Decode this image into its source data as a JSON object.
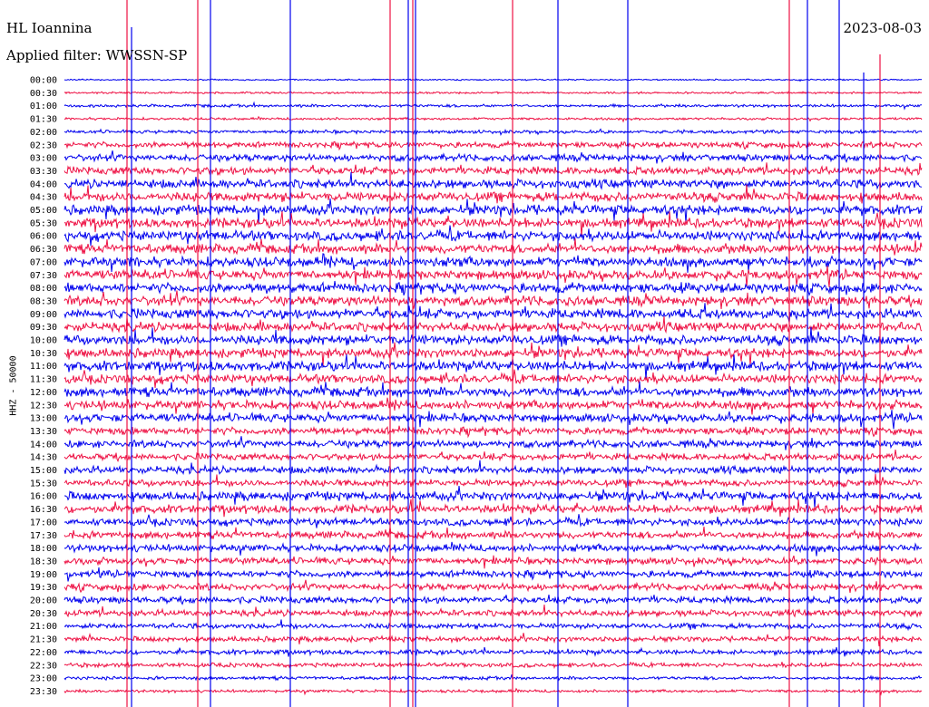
{
  "header": {
    "station": "HL Ioannina",
    "filter": "Applied filter: WWSSN-SP",
    "date": "2023-08-03"
  },
  "chart_data": {
    "type": "line",
    "title": "HL Ioannina",
    "ylabel": "HHZ - 50000",
    "rows": [
      "00:00",
      "00:30",
      "01:00",
      "01:30",
      "02:00",
      "02:30",
      "03:00",
      "03:30",
      "04:00",
      "04:30",
      "05:00",
      "05:30",
      "06:00",
      "06:30",
      "07:00",
      "07:30",
      "08:00",
      "08:30",
      "09:00",
      "09:30",
      "10:00",
      "10:30",
      "11:00",
      "11:30",
      "12:00",
      "12:30",
      "13:00",
      "13:30",
      "14:00",
      "14:30",
      "15:00",
      "15:30",
      "16:00",
      "16:30",
      "17:00",
      "17:30",
      "18:00",
      "18:30",
      "19:00",
      "19:30",
      "20:00",
      "20:30",
      "21:00",
      "21:30",
      "22:00",
      "22:30",
      "23:00",
      "23:30"
    ],
    "series_colors": [
      "#0000ee",
      "#ee1144"
    ],
    "activity": [
      0.15,
      0.2,
      0.3,
      0.25,
      0.35,
      0.6,
      0.7,
      0.8,
      0.9,
      0.95,
      1.0,
      1.0,
      1.0,
      0.95,
      1.0,
      0.95,
      1.0,
      1.0,
      1.0,
      0.95,
      1.0,
      0.95,
      1.0,
      0.9,
      0.95,
      0.9,
      0.85,
      0.75,
      0.75,
      0.7,
      0.75,
      0.7,
      0.9,
      0.85,
      0.75,
      0.75,
      0.75,
      0.7,
      0.7,
      0.7,
      0.7,
      0.65,
      0.55,
      0.55,
      0.5,
      0.45,
      0.35,
      0.3
    ]
  }
}
